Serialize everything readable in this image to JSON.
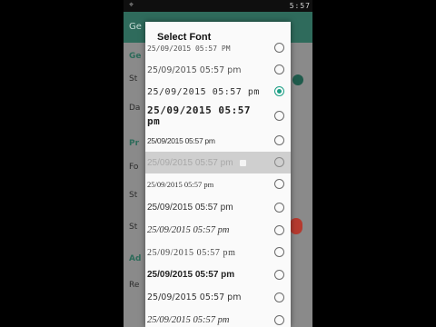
{
  "status_bar": {
    "left_icon": "notification-icon",
    "time": "5:57"
  },
  "app_bar": {
    "title": "Ge"
  },
  "background_settings": [
    {
      "text": "Ge",
      "category": true
    },
    {
      "text": "St",
      "category": false
    },
    {
      "text": "Da",
      "category": false
    },
    {
      "text": "Pr",
      "category": true
    },
    {
      "text": "Fo",
      "category": false
    },
    {
      "text": "St",
      "category": false
    },
    {
      "text": "St",
      "category": false
    },
    {
      "text": "Ad",
      "category": true
    },
    {
      "text": "Re",
      "category": false
    }
  ],
  "dialog": {
    "title": "Select Font",
    "options": [
      {
        "label": "25/09/2015 05:57 PM",
        "selected": false
      },
      {
        "label": "25/09/2015 05:57 pm",
        "selected": false
      },
      {
        "label": "25/09/2015 05:57 pm",
        "selected": true
      },
      {
        "label": "25/09/2015 05:57 pm",
        "selected": false
      },
      {
        "label": "25/09/2015 05:57 pm",
        "selected": false
      },
      {
        "label": "25/09/2015 05:57 pm",
        "selected": false,
        "pressed": true
      },
      {
        "label": "25/09/2015 05:57 pm",
        "selected": false
      },
      {
        "label": "25/09/2015 05:57 pm",
        "selected": false
      },
      {
        "label": "25/09/2015 05:57 pm",
        "selected": false
      },
      {
        "label": "25/09/2015 05:57 pm",
        "selected": false
      },
      {
        "label": "25/09/2015 05:57 pm",
        "selected": false
      },
      {
        "label": "25/09/2015 05:57 pm",
        "selected": false
      },
      {
        "label": "25/09/2015 05:57 pm",
        "selected": false
      }
    ]
  },
  "colors": {
    "accent": "#1a9e84",
    "app_bar": "#2f6b5c",
    "scrim": "#7d7d7d"
  }
}
